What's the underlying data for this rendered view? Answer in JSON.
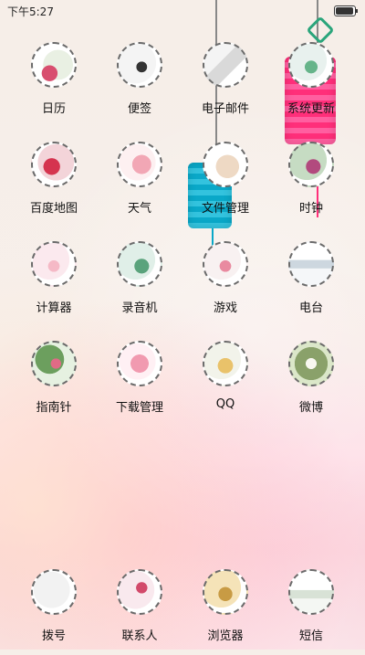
{
  "status_bar": {
    "time": "下午5:27"
  },
  "apps": {
    "a1": "日历",
    "a2": "便签",
    "a3": "电子邮件",
    "a4": "系统更新",
    "a5": "百度地图",
    "a6": "天气",
    "a7": "文件管理",
    "a8": "时钟",
    "a9": "计算器",
    "a10": "录音机",
    "a11": "游戏",
    "a12": "电台",
    "a13": "指南针",
    "a14": "下载管理",
    "a15": "QQ",
    "a16": "微博"
  },
  "dock": {
    "d1": "拨号",
    "d2": "联系人",
    "d3": "浏览器",
    "d4": "短信"
  },
  "icons": {
    "a1": "calendar-icon",
    "a2": "notes-icon",
    "a3": "email-icon",
    "a4": "system-update-icon",
    "a5": "baidu-map-icon",
    "a6": "weather-icon",
    "a7": "file-manager-icon",
    "a8": "clock-icon",
    "a9": "calculator-icon",
    "a10": "recorder-icon",
    "a11": "games-icon",
    "a12": "radio-icon",
    "a13": "compass-icon",
    "a14": "downloads-icon",
    "a15": "qq-icon",
    "a16": "weibo-icon",
    "d1": "dialer-icon",
    "d2": "contacts-icon",
    "d3": "browser-icon",
    "d4": "sms-icon"
  }
}
